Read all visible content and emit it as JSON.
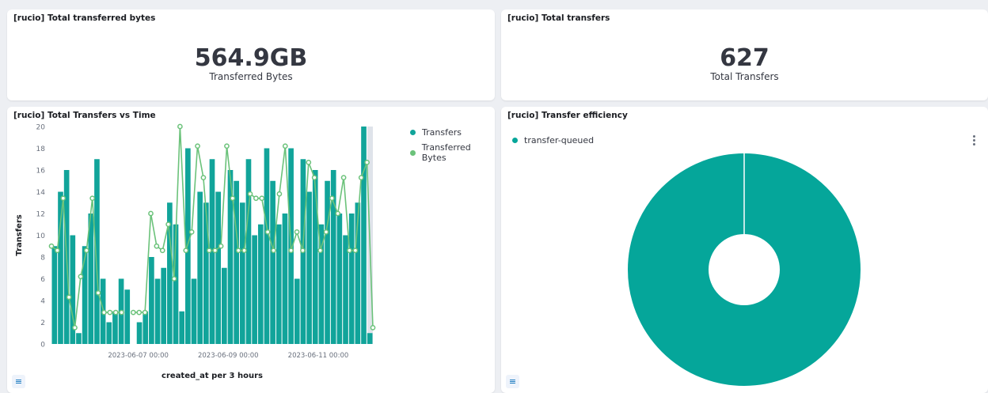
{
  "panels": {
    "bytes": {
      "title": "[rucio] Total transferred bytes",
      "value": "564.9GB",
      "label": "Transferred Bytes"
    },
    "transfers": {
      "title": "[rucio] Total transfers",
      "value": "627",
      "label": "Total Transfers"
    },
    "time_chart": {
      "title": "[rucio] Total Transfers vs Time",
      "legend": [
        "Transfers",
        "Transferred Bytes"
      ],
      "legend_toggle_icon": "list-icon"
    },
    "efficiency": {
      "title": "[rucio] Transfer efficiency",
      "legend": [
        "transfer-queued"
      ],
      "menu_icon": "vertical-dots-icon",
      "legend_toggle_icon": "list-icon"
    }
  },
  "colors": {
    "bar": "#11a49a",
    "line": "#6bc27a",
    "donut": "#05a69a",
    "background": "#edeff3"
  },
  "chart_data": [
    {
      "type": "bar",
      "title": "[rucio] Total Transfers vs Time",
      "xlabel": "created_at per 3 hours",
      "ylabel": "Transfers",
      "ylim": [
        0,
        20
      ],
      "yticks": [
        "0",
        "2",
        "4",
        "6",
        "8",
        "10",
        "12",
        "14",
        "16",
        "18",
        "20"
      ],
      "xticks": [
        "2023-06-07 00:00",
        "2023-06-09 00:00",
        "2023-06-11 00:00"
      ],
      "legend_position": "top-right",
      "series": [
        {
          "name": "Transfers",
          "type": "bar",
          "values": [
            9,
            14,
            16,
            10,
            1,
            9,
            12,
            17,
            6,
            2,
            3,
            6,
            5,
            0,
            2,
            3,
            8,
            6,
            7,
            13,
            11,
            3,
            18,
            6,
            14,
            13,
            17,
            14,
            7,
            16,
            15,
            13,
            17,
            10,
            11,
            18,
            15,
            11,
            12,
            18,
            6,
            17,
            14,
            16,
            11,
            15,
            16,
            12,
            10,
            12,
            13,
            20,
            1
          ]
        },
        {
          "name": "Transferred Bytes",
          "type": "line",
          "values": [
            9,
            8.6,
            13.4,
            4.3,
            1.5,
            6.2,
            8.6,
            13.4,
            4.7,
            2.9,
            2.9,
            2.9,
            2.9,
            null,
            2.9,
            2.9,
            2.9,
            12,
            9,
            8.6,
            11,
            6,
            20,
            8.6,
            10.3,
            18.2,
            15.3,
            8.6,
            8.6,
            9,
            18.2,
            13.4,
            8.6,
            8.6,
            13.8,
            13.4,
            13.4,
            10.3,
            8.6,
            13.8,
            18.2,
            8.6,
            10.3,
            8.6,
            16.7,
            15.3,
            8.6,
            10.3,
            13.4,
            12,
            15.3,
            8.6,
            8.6,
            15.3,
            16.7,
            1.5
          ]
        }
      ]
    },
    {
      "type": "pie",
      "title": "[rucio] Transfer efficiency",
      "categories": [
        "transfer-queued"
      ],
      "values": [
        100
      ]
    }
  ]
}
